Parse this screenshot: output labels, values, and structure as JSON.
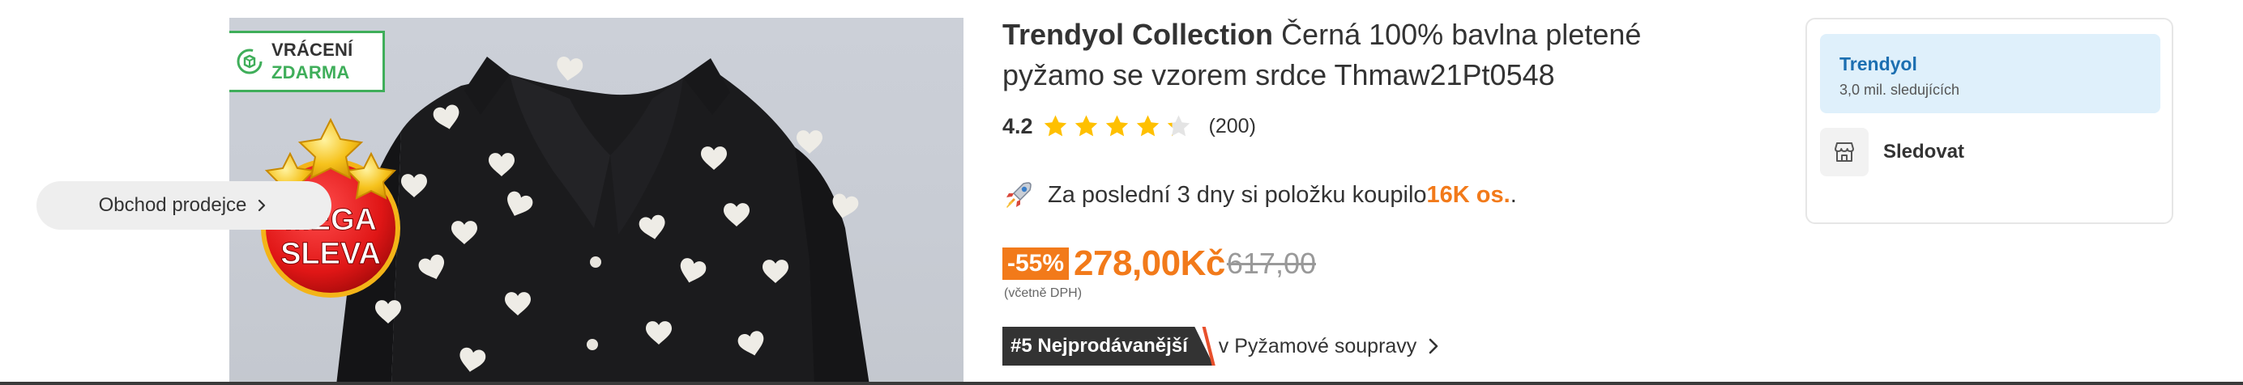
{
  "product_image": {
    "free_return": {
      "line1": "VRÁCENÍ",
      "line2": "ZDARMA",
      "icon": "return-package-icon"
    },
    "badge": {
      "line1": "MEGA",
      "line2": "SLEVA",
      "icon": "stars-icon"
    }
  },
  "product": {
    "brand": "Trendyol Collection",
    "title": "Černá 100% bavlna pletené pyžamo se vzorem srdce Thmaw21Pt0548",
    "rating": {
      "value": "4.2",
      "count": "(200)",
      "stars_filled": 4.2,
      "stars_total": 5
    }
  },
  "social_proof": {
    "icon": "rocket-icon",
    "text": "Za poslední 3 dny si položku koupilo ",
    "highlight": "16K os.",
    "suffix": "."
  },
  "price": {
    "discount": "-55%",
    "current": "278,00",
    "currency": "Kč",
    "old": "617,00",
    "vat_note": "(včetně DPH)"
  },
  "bestseller": {
    "tag": "#5 Nejprodávanější",
    "category": "v Pyžamové soupravy",
    "icon": "chevron-right-icon"
  },
  "seller": {
    "name": "Trendyol",
    "followers": "3,0 mil. sledujících",
    "follow_label": "Sledovat",
    "store_button": "Obchod prodejce",
    "icon": "store-icon"
  },
  "colors": {
    "accent": "#f27a1a",
    "green": "#3fae5a",
    "seller_blue": "#1c6fb1",
    "seller_bg": "#dff0fb",
    "dark": "#333333"
  }
}
